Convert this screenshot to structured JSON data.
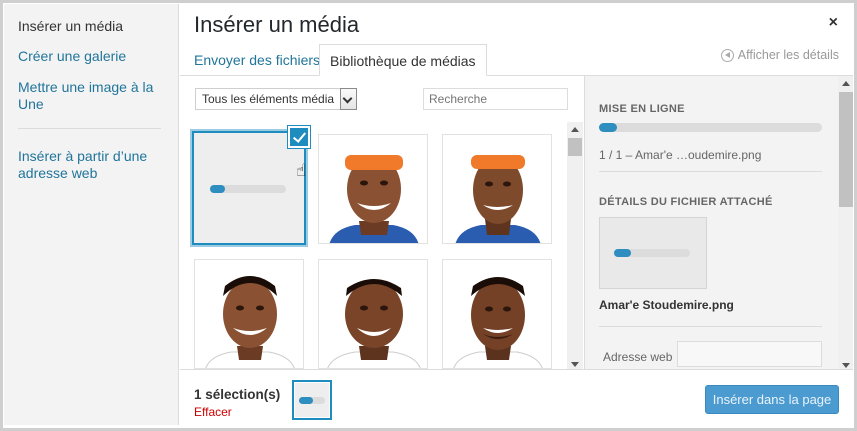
{
  "sidebar": {
    "items": [
      {
        "label": "Insérer un média"
      },
      {
        "label": "Créer une galerie"
      },
      {
        "label": "Mettre une image à la Une"
      },
      {
        "label": "Insérer à partir d’une adresse web"
      }
    ]
  },
  "modal": {
    "title": "Insérer un média",
    "close_glyph": "×"
  },
  "tabs": [
    {
      "label": "Envoyer des fichiers"
    },
    {
      "label": "Bibliothèque de médias"
    }
  ],
  "details_link": "Afficher les détails",
  "toolbar": {
    "filter_value": "Tous les éléments média",
    "search_placeholder": "Recherche"
  },
  "grid": {
    "uploading_tile_progress": 0.2,
    "tiles_visible": 6
  },
  "panel": {
    "upload_heading": "MISE EN LIGNE",
    "upload_progress": 0.08,
    "upload_status": "1 / 1  –  Amar'e …oudemire.png",
    "details_heading": "DÉTAILS DU FICHIER ATTACHÉ",
    "thumb_progress": 0.22,
    "file_name": "Amar'e Stoudemire.png",
    "web_address_label": "Adresse web",
    "web_address_value": ""
  },
  "footer": {
    "selection_count": "1 sélection(s)",
    "clear_label": "Effacer",
    "insert_label": "Insérer dans la page"
  },
  "colors": {
    "accent": "#1e8cbe",
    "link": "#21759b",
    "danger": "#cc0000",
    "headband": "#f07a2a",
    "jersey": "#2a5db0"
  }
}
